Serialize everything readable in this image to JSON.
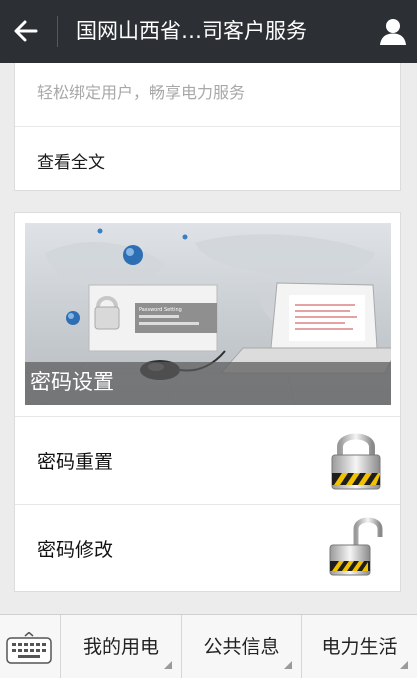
{
  "header": {
    "title": "国网山西省…司客户服务",
    "back_icon": "arrow-left-icon",
    "profile_icon": "person-icon",
    "background_color": "#2c2f33"
  },
  "article_card": {
    "description": "轻松绑定用户，畅享电力服务",
    "read_more": "查看全文"
  },
  "news_card": {
    "cover": {
      "title": "密码设置",
      "mini_window_title": "Password Setting"
    },
    "items": [
      {
        "label": "密码重置",
        "icon": "padlock-open-icon"
      },
      {
        "label": "密码修改",
        "icon": "padlock-unlocked-icon"
      }
    ]
  },
  "bottom_menu": {
    "keyboard_icon": "keyboard-icon",
    "items": [
      {
        "label": "我的用电"
      },
      {
        "label": "公共信息"
      },
      {
        "label": "电力生活"
      }
    ]
  }
}
